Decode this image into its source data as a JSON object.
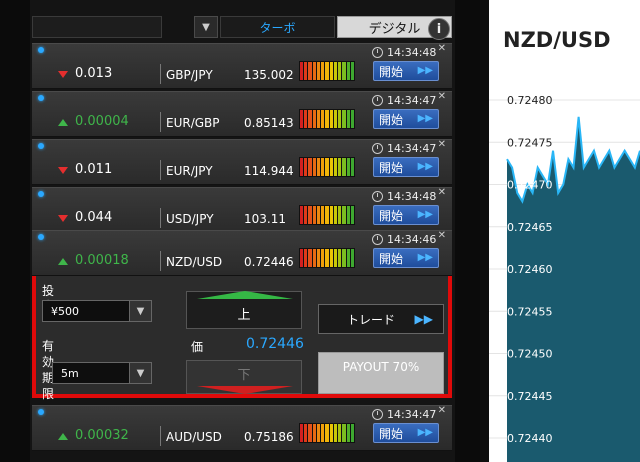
{
  "topbar": {
    "dropdown_arrow": "▼",
    "tab_turbo": "ターボ",
    "tab_digital": "デジタル",
    "info": "i"
  },
  "rows": [
    {
      "direction": "down",
      "change": "0.013",
      "pair": "GBP/JPY",
      "rate": "135.002",
      "time": "14:34:48",
      "start": "開始"
    },
    {
      "direction": "up",
      "change": "0.00004",
      "pair": "EUR/GBP",
      "rate": "0.85143",
      "time": "14:34:47",
      "start": "開始"
    },
    {
      "direction": "down",
      "change": "0.011",
      "pair": "EUR/JPY",
      "rate": "114.944",
      "time": "14:34:47",
      "start": "開始"
    },
    {
      "direction": "down",
      "change": "0.044",
      "pair": "USD/JPY",
      "rate": "103.11",
      "time": "14:34:48",
      "start": "開始"
    },
    {
      "direction": "up",
      "change": "0.00032",
      "pair": "AUD/USD",
      "rate": "0.75186",
      "time": "14:34:47",
      "start": "開始"
    }
  ],
  "expanded": {
    "direction": "up",
    "change": "0.00018",
    "pair": "NZD/USD",
    "rate": "0.72446",
    "time": "14:34:46",
    "start": "開始",
    "invest_label": "投資",
    "invest_value": "¥500",
    "expiry_label": "有効期限",
    "expiry_value": "5m",
    "up_label": "上",
    "down_label": "下",
    "price_label": "価",
    "price_value": "0.72446",
    "trade_label": "トレード",
    "payout_label": "PAYOUT 70%"
  },
  "signal_colors": [
    "#d42020",
    "#e03a1a",
    "#e4521a",
    "#e86a14",
    "#ec8810",
    "#f0a00a",
    "#f2b608",
    "#e8c406",
    "#c8c808",
    "#a8c410",
    "#7cbd20",
    "#50b02a",
    "#3ea830"
  ],
  "chevrons": "▶▶",
  "chart": {
    "title": "NZD/USD",
    "y_ticks": [
      "0.72480",
      "0.72475",
      "0.72470",
      "0.72465",
      "0.72460",
      "0.72455",
      "0.72450",
      "0.72445",
      "0.72440"
    ]
  },
  "chart_data": {
    "type": "area",
    "title": "NZD/USD",
    "ylim": [
      0.72438,
      0.72483
    ],
    "y_ticks": [
      0.7248,
      0.72475,
      0.7247,
      0.72465,
      0.7246,
      0.72455,
      0.7245,
      0.72445,
      0.7244
    ],
    "values": [
      0.72473,
      0.72472,
      0.72469,
      0.72468,
      0.7247,
      0.72469,
      0.72472,
      0.72471,
      0.7247,
      0.72474,
      0.72469,
      0.7247,
      0.72473,
      0.72472,
      0.72478,
      0.72472,
      0.72473,
      0.72474,
      0.72472,
      0.72473,
      0.72474,
      0.72472,
      0.72473,
      0.72474,
      0.72473,
      0.72472,
      0.72474
    ],
    "grid": true
  }
}
